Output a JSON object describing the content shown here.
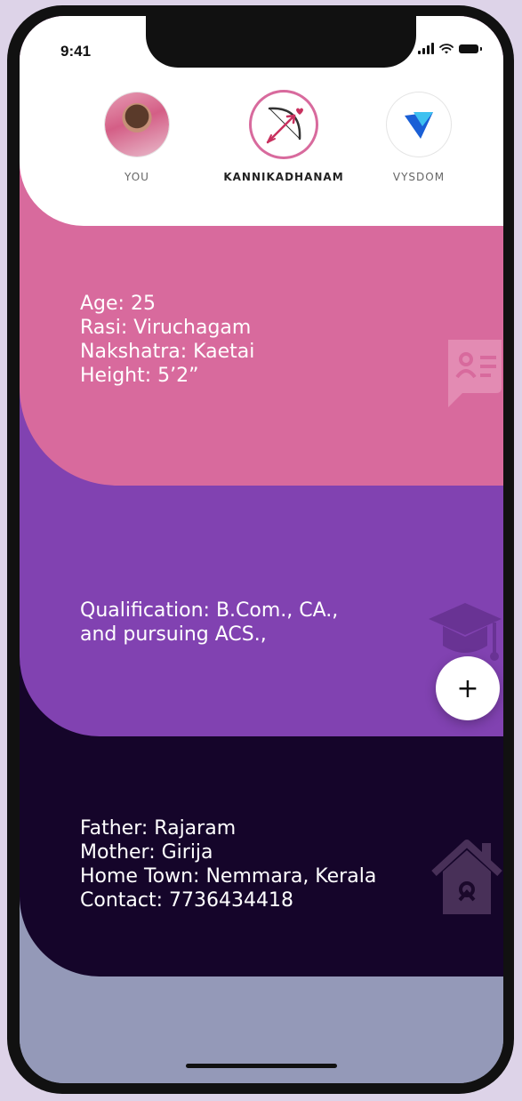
{
  "status_bar": {
    "time": "9:41"
  },
  "stories": [
    {
      "label": "YOU",
      "icon": "profile-photo"
    },
    {
      "label": "KANNIKADHANAM",
      "icon": "bow-arrow-icon"
    },
    {
      "label": "VYSDOM",
      "icon": "vysdom-logo-icon"
    }
  ],
  "cards": {
    "personal": {
      "icon": "profile-card-icon",
      "lines": [
        "Age: 25",
        "Rasi: Viruchagam",
        "Nakshatra: Kaetai",
        "Height: 5’2”"
      ]
    },
    "education": {
      "icon": "graduation-cap-icon",
      "lines": [
        "Qualification: B.Com., CA.,",
        "and pursuing ACS.,"
      ]
    },
    "family": {
      "icon": "home-icon",
      "lines": [
        "Father: Rajaram",
        "Mother: Girija",
        "Home Town: Nemmara, Kerala",
        "Contact: 7736434418"
      ]
    }
  },
  "fab": {
    "label": "+"
  },
  "colors": {
    "personal": "#d86a9d",
    "education": "#8142b1",
    "family": "#15052a",
    "footer": "#9499b8",
    "vysdom_blue": "#1a5fd6"
  }
}
